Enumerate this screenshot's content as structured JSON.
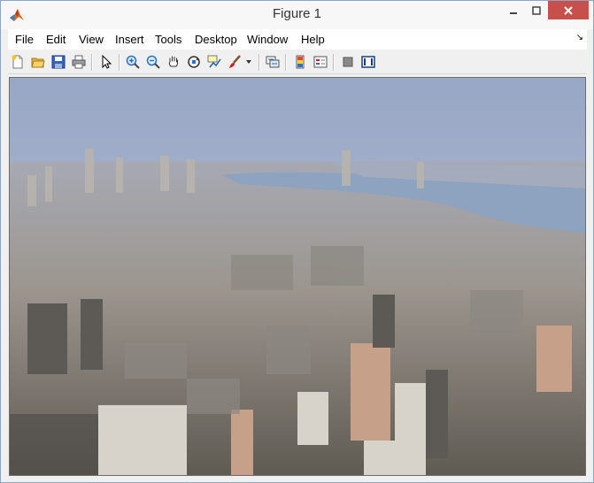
{
  "window": {
    "title": "Figure 1"
  },
  "menu": [
    "File",
    "Edit",
    "View",
    "Insert",
    "Tools",
    "Desktop",
    "Window",
    "Help"
  ],
  "toolbar": [
    "new-figure-icon",
    "open-file-icon",
    "save-icon",
    "print-icon",
    "pointer-arrow-icon",
    "zoom-in-icon",
    "zoom-out-icon",
    "pan-hand-icon",
    "rotate-3d-icon",
    "data-cursor-icon",
    "brush-icon",
    "dropdown-arrow-icon",
    "link-plot-icon",
    "colorbar-icon",
    "legend-icon",
    "hide-plot-tools-icon",
    "show-plot-tools-icon"
  ],
  "colors": {
    "sky": "#a9b8d2",
    "water": "#8ea3bf",
    "close_button": "#c7504b"
  }
}
